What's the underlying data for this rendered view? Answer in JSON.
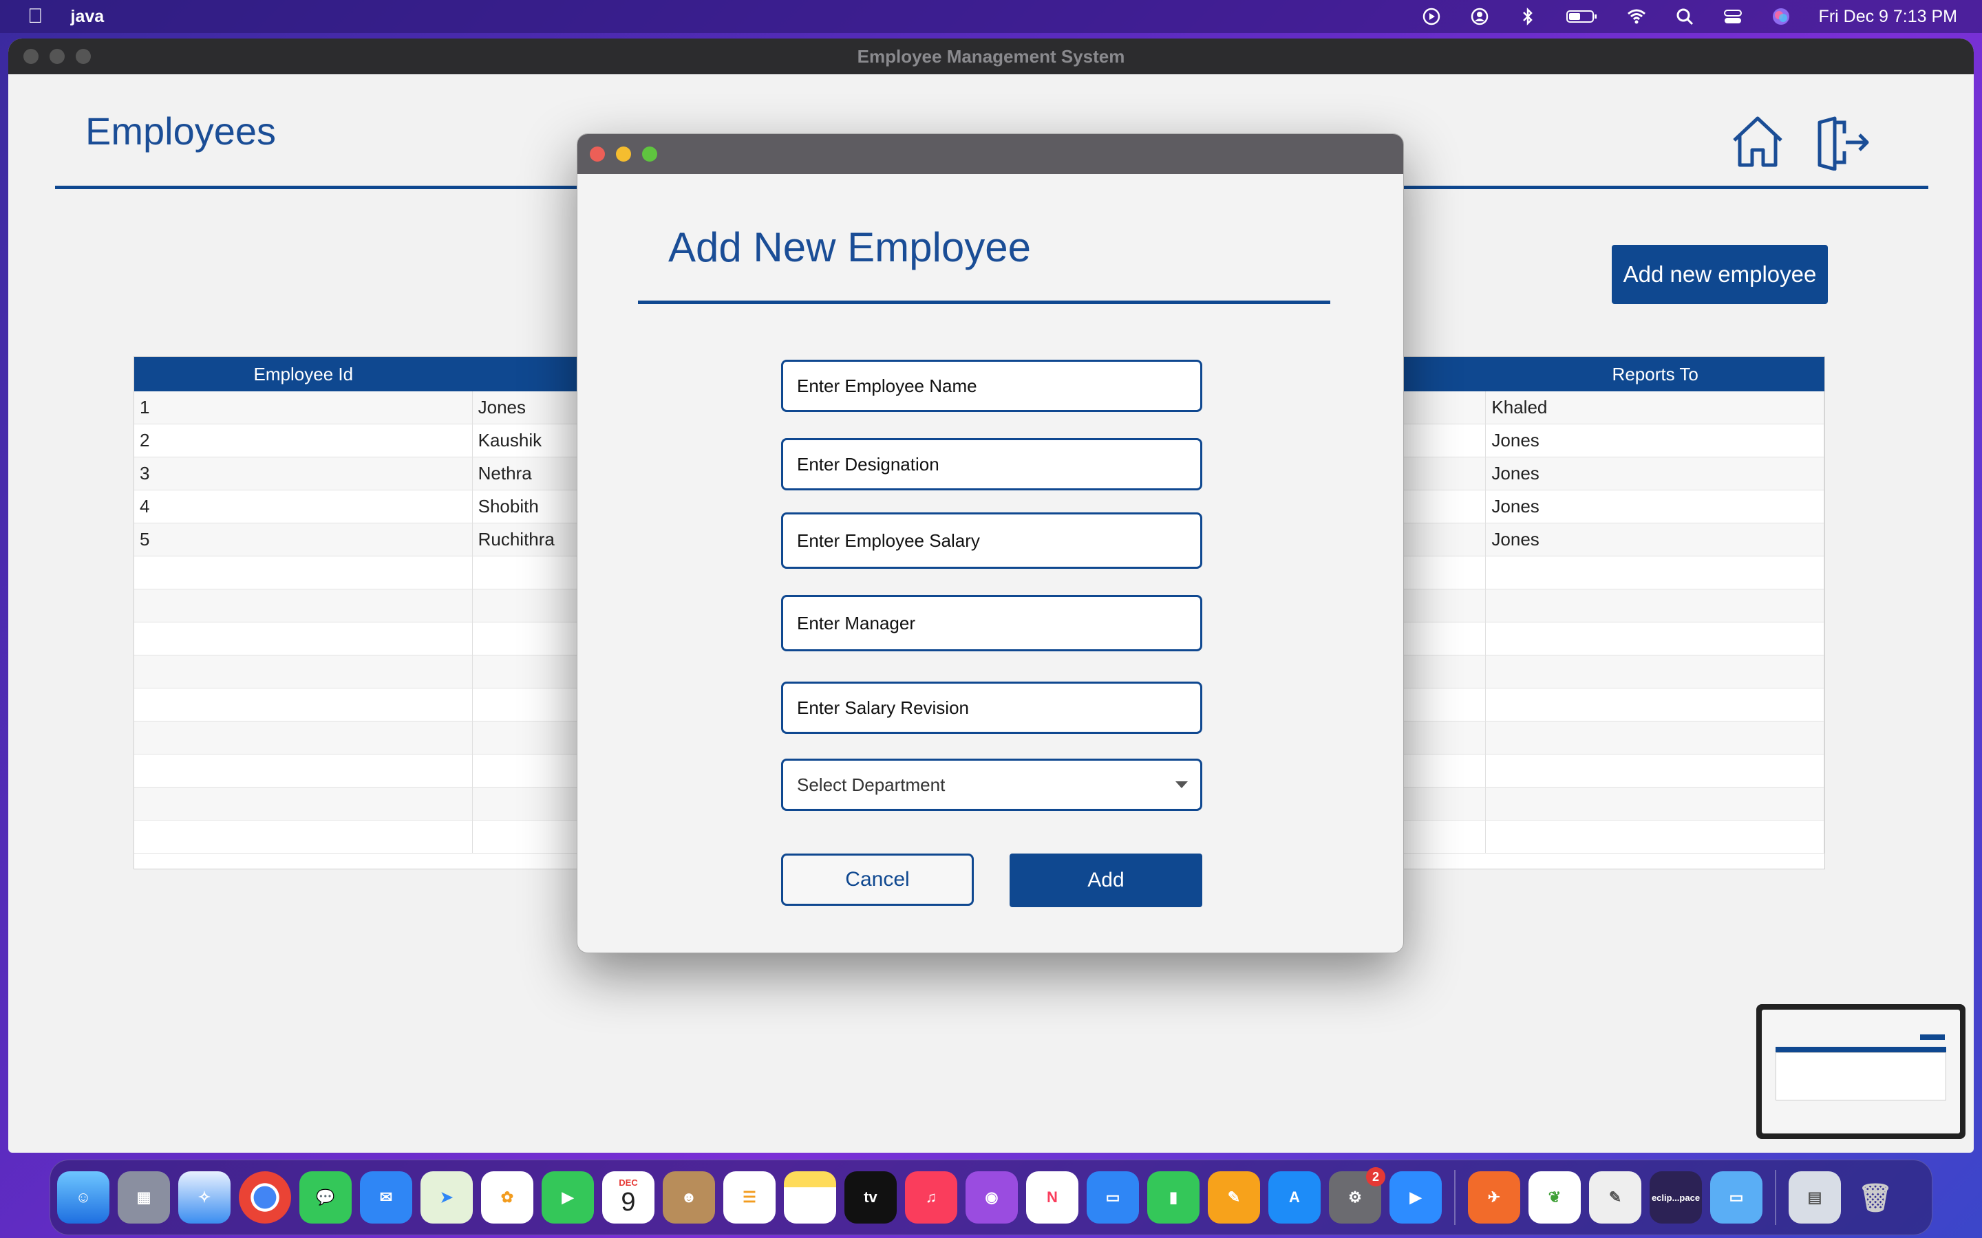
{
  "menubar": {
    "app_name": "java",
    "datetime": "Fri Dec 9  7:13 PM"
  },
  "window": {
    "title": "Employee Management System"
  },
  "page": {
    "title": "Employees",
    "add_new_label": "Add new employee"
  },
  "table": {
    "headers": [
      "Employee Id",
      "",
      "Reports To"
    ],
    "rows": [
      {
        "id": "1",
        "name": "Jones",
        "reports_to": "Khaled"
      },
      {
        "id": "2",
        "name": "Kaushik",
        "reports_to": "Jones"
      },
      {
        "id": "3",
        "name": "Nethra",
        "reports_to": "Jones"
      },
      {
        "id": "4",
        "name": "Shobith",
        "reports_to": "Jones"
      },
      {
        "id": "5",
        "name": "Ruchithra",
        "reports_to": "Jones"
      }
    ]
  },
  "dialog": {
    "title": "Add New Employee",
    "name_placeholder": "Enter Employee Name",
    "designation_placeholder": "Enter Designation",
    "salary_placeholder": "Enter Employee Salary",
    "manager_placeholder": "Enter Manager",
    "revision_placeholder": "Enter Salary Revision",
    "department_select": "Select Department",
    "cancel_label": "Cancel",
    "add_label": "Add"
  },
  "dock": {
    "calendar_month": "DEC",
    "calendar_day": "9",
    "tv_label": "tv",
    "settings_badge": "2",
    "eclipse_label": "eclip...pace"
  },
  "colors": {
    "accent": "#0f4890",
    "title_text": "#1a4d96"
  }
}
